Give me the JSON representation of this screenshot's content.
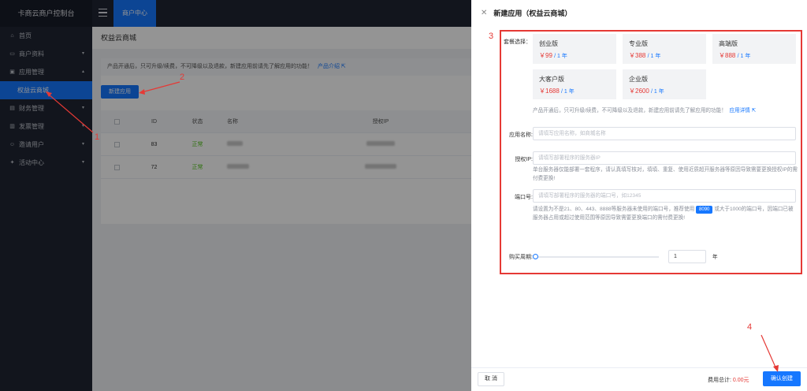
{
  "sidebar": {
    "title": "卡商云商户控制台",
    "items": [
      {
        "label": "首页",
        "icon": "home-icon",
        "glyph": "⌂"
      },
      {
        "label": "商户资料",
        "icon": "id-card-icon",
        "glyph": "▭",
        "arrow": "▾"
      },
      {
        "label": "应用管理",
        "icon": "app-icon",
        "glyph": "▣",
        "arrow": "▴"
      },
      {
        "label": "权益云商城",
        "sub": true,
        "active": true
      },
      {
        "label": "财务管理",
        "icon": "finance-icon",
        "glyph": "▤",
        "arrow": "▾"
      },
      {
        "label": "发票管理",
        "icon": "invoice-icon",
        "glyph": "▥",
        "arrow": "▾"
      },
      {
        "label": "邀请用户",
        "icon": "user-icon",
        "glyph": "☺",
        "arrow": "▾"
      },
      {
        "label": "活动中心",
        "icon": "gift-icon",
        "glyph": "✦",
        "arrow": "▾"
      }
    ]
  },
  "topbar": {
    "tab": "商户中心"
  },
  "main": {
    "page_title": "权益云商城",
    "notice": "产品开通后，只可升级/续费，不可降级以及退款，新建应用前请先了解应用的功能！",
    "notice_link": "产品介绍 ⇱",
    "new_button": "新建应用",
    "table": {
      "headers": [
        "ID",
        "状态",
        "名称",
        "授权IP"
      ],
      "rows": [
        {
          "id": "83",
          "status": "正常"
        },
        {
          "id": "72",
          "status": "正常"
        }
      ]
    }
  },
  "drawer": {
    "title": "新建应用（权益云商城）",
    "package_label": "套餐选择：",
    "packages": [
      {
        "name": "创业版",
        "price": "￥99",
        "per": "/ 1 年"
      },
      {
        "name": "专业版",
        "price": "￥388",
        "per": "/ 1 年"
      },
      {
        "name": "高端版",
        "price": "￥888",
        "per": "/ 1 年"
      },
      {
        "name": "大客户版",
        "price": "￥1688",
        "per": "/ 1 年"
      },
      {
        "name": "企业版",
        "price": "￥2600",
        "per": "/ 1 年"
      }
    ],
    "package_hint": "产品开通后，只可升级/续费，不可降级以及退款，新建应用前请先了解应用的功能！",
    "package_hint_link": "应用详情 ⇱",
    "app_name_label": "应用名称:",
    "app_name_placeholder": "请填写应用名称，如商城名称",
    "ip_label": "授权IP:",
    "ip_placeholder": "请填写部署程序的服务器IP",
    "ip_hint": "单台服务器仅能部署一套程序，请认真填写核对，填填、重复、使用近质超开服务器等原因导致需要更换授权IP的需付费更换!",
    "port_label": "端口号:",
    "port_placeholder": "请填写部署程序的服务器的端口号，如12345",
    "port_hint_a": "请设置为不是21、80、443、8888等服务器未使用的端口号，推荐使用",
    "port_tag": "8090",
    "port_hint_b": "或大于1000的端口号，因端口已被服务器占用或超过使用范围等原因导致需要更换端口的需付费更换!",
    "period_label": "购买周期:",
    "period_value": "1",
    "period_unit": "年",
    "cancel": "取 消",
    "total_label": "费用总计:",
    "total_amount": "0.00元",
    "confirm": "确认创建"
  },
  "annotations": [
    "1",
    "2",
    "3",
    "4"
  ]
}
